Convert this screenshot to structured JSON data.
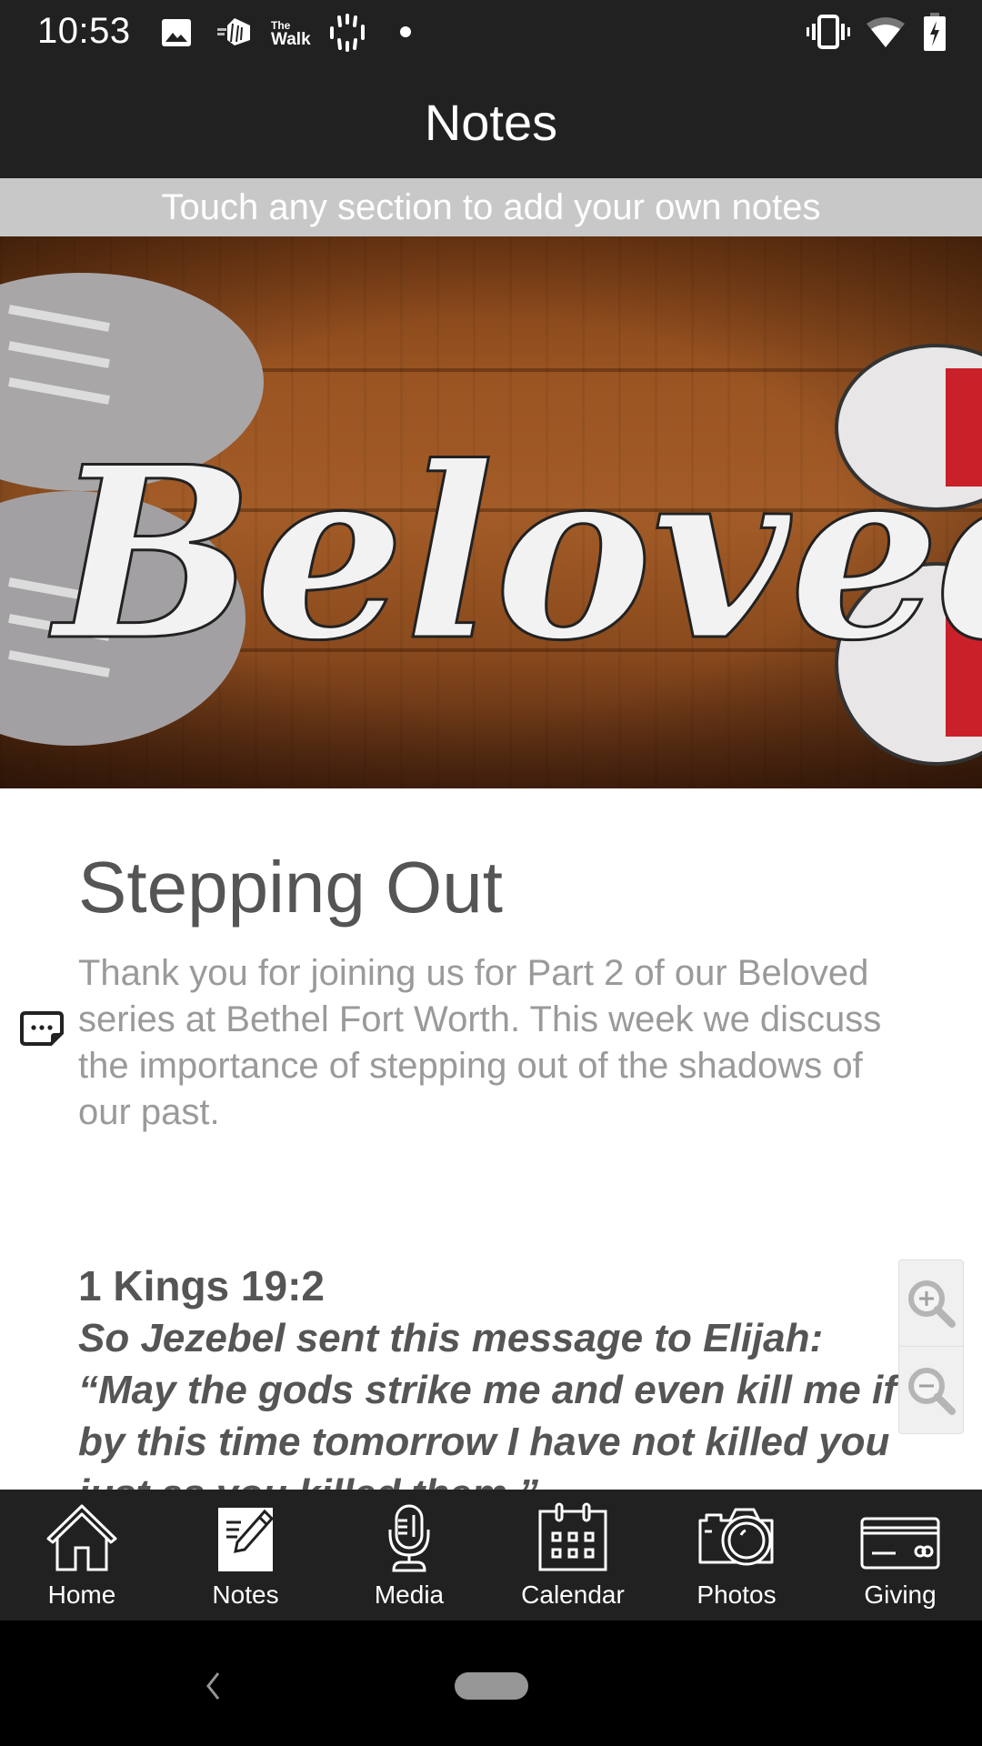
{
  "status_bar": {
    "time": "10:53",
    "left_icons": [
      "image-icon",
      "hill-app-icon",
      "the-walk-app-icon",
      "loading-ring-icon",
      "dot-icon"
    ],
    "walk_label_top": "The",
    "walk_label_bottom": "Walk",
    "right_icons": [
      "vibrate-icon",
      "wifi-icon",
      "battery-charging-icon"
    ]
  },
  "header": {
    "title": "Notes"
  },
  "hint": {
    "text": "Touch any section to add your own notes"
  },
  "banner": {
    "alt": "Beloved",
    "script_text": "Beloved"
  },
  "note": {
    "title": "Stepping Out",
    "description": "Thank you for joining us for Part 2 of our Beloved series at Bethel Fort Worth. This week we discuss the importance of stepping out of the shadows of our past.",
    "note_icon": "add-note-icon"
  },
  "verse": {
    "reference": "1 Kings 19:2",
    "text": "So Jezebel sent this message to Elijah: “May the gods strike me and even kill me if by this time tomorrow I have not killed you just as you killed them.”"
  },
  "zoom_controls": {
    "zoom_in": "zoom-in-icon",
    "zoom_out": "zoom-out-icon"
  },
  "bottom_nav": {
    "items": [
      {
        "label": "Home",
        "icon": "home-icon"
      },
      {
        "label": "Notes",
        "icon": "notes-icon",
        "active": true
      },
      {
        "label": "Media",
        "icon": "microphone-icon"
      },
      {
        "label": "Calendar",
        "icon": "calendar-icon"
      },
      {
        "label": "Photos",
        "icon": "camera-icon"
      },
      {
        "label": "Giving",
        "icon": "credit-card-icon"
      }
    ]
  },
  "colors": {
    "bar_dark": "#212121",
    "hint_bar": "#c8c8c8",
    "title_text": "#555555",
    "body_text": "#9a9a9a"
  }
}
